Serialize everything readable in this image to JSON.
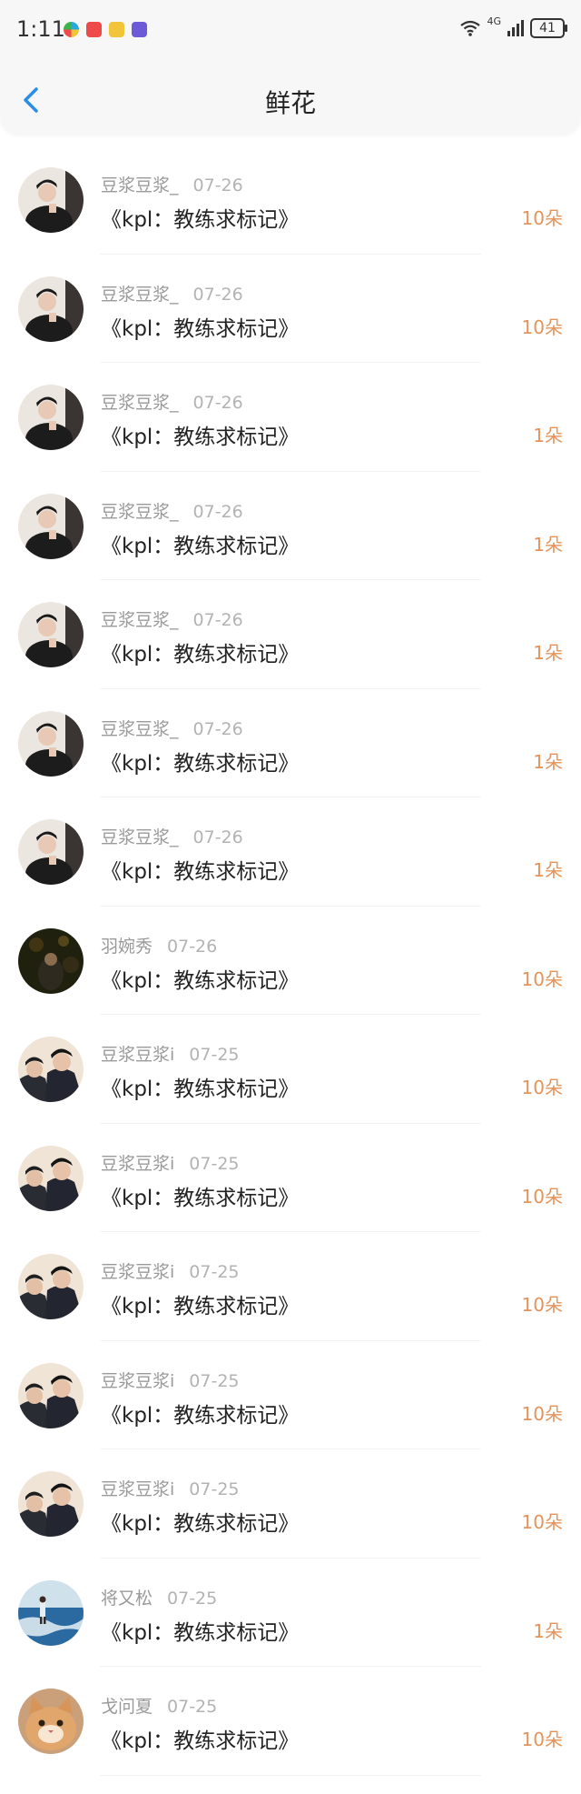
{
  "status": {
    "time": "1:11",
    "network": "4G",
    "battery": "41",
    "app_icons": [
      {
        "name": "colorful-app-icon",
        "color": "#2aa7e0"
      },
      {
        "name": "red-app-icon",
        "color": "#ef4a4a"
      },
      {
        "name": "yellow-app-icon",
        "color": "#f2c43a"
      },
      {
        "name": "purple-app-icon",
        "color": "#6b5bd6"
      }
    ]
  },
  "nav": {
    "title": "鲜花"
  },
  "colors": {
    "accent_blue": "#2a8ee8",
    "count_orange": "#e4935a"
  },
  "rows": [
    {
      "user": "豆浆豆浆_",
      "date": "07-26",
      "title": "《kpl：教练求标记》",
      "count": "10朵",
      "avatar": "a"
    },
    {
      "user": "豆浆豆浆_",
      "date": "07-26",
      "title": "《kpl：教练求标记》",
      "count": "10朵",
      "avatar": "a"
    },
    {
      "user": "豆浆豆浆_",
      "date": "07-26",
      "title": "《kpl：教练求标记》",
      "count": "1朵",
      "avatar": "a"
    },
    {
      "user": "豆浆豆浆_",
      "date": "07-26",
      "title": "《kpl：教练求标记》",
      "count": "1朵",
      "avatar": "a"
    },
    {
      "user": "豆浆豆浆_",
      "date": "07-26",
      "title": "《kpl：教练求标记》",
      "count": "1朵",
      "avatar": "a"
    },
    {
      "user": "豆浆豆浆_",
      "date": "07-26",
      "title": "《kpl：教练求标记》",
      "count": "1朵",
      "avatar": "a"
    },
    {
      "user": "豆浆豆浆_",
      "date": "07-26",
      "title": "《kpl：教练求标记》",
      "count": "1朵",
      "avatar": "a"
    },
    {
      "user": "羽婉秀",
      "date": "07-26",
      "title": "《kpl：教练求标记》",
      "count": "10朵",
      "avatar": "b"
    },
    {
      "user": "豆浆豆浆i",
      "date": "07-25",
      "title": "《kpl：教练求标记》",
      "count": "10朵",
      "avatar": "c"
    },
    {
      "user": "豆浆豆浆i",
      "date": "07-25",
      "title": "《kpl：教练求标记》",
      "count": "10朵",
      "avatar": "c"
    },
    {
      "user": "豆浆豆浆i",
      "date": "07-25",
      "title": "《kpl：教练求标记》",
      "count": "10朵",
      "avatar": "c"
    },
    {
      "user": "豆浆豆浆i",
      "date": "07-25",
      "title": "《kpl：教练求标记》",
      "count": "10朵",
      "avatar": "c"
    },
    {
      "user": "豆浆豆浆i",
      "date": "07-25",
      "title": "《kpl：教练求标记》",
      "count": "10朵",
      "avatar": "c"
    },
    {
      "user": "将又松",
      "date": "07-25",
      "title": "《kpl：教练求标记》",
      "count": "1朵",
      "avatar": "d"
    },
    {
      "user": "戈问夏",
      "date": "07-25",
      "title": "《kpl：教练求标记》",
      "count": "10朵",
      "avatar": "e"
    }
  ]
}
